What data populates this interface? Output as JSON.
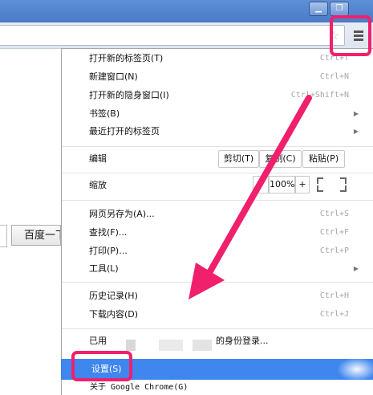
{
  "window": {
    "minimize_glyph": "▁",
    "maximize_glyph": "❐"
  },
  "page": {
    "baidu_button": "百度一下"
  },
  "menu": {
    "items": [
      {
        "label": "打开新的标签页(T)",
        "shortcut": "Ctrl+T"
      },
      {
        "label": "新建窗口(N)",
        "shortcut": "Ctrl+N"
      },
      {
        "label": "打开新的隐身窗口(I)",
        "shortcut": "Ctrl+Shift+N"
      },
      {
        "label": "书签(B)",
        "submenu": true
      },
      {
        "label": "最近打开的标签页",
        "submenu": true
      },
      {
        "label": "编辑"
      },
      {
        "label": "缩放"
      },
      {
        "label": "网页另存为(A)...",
        "shortcut": "Ctrl+S"
      },
      {
        "label": "查找(F)...",
        "shortcut": "Ctrl+F"
      },
      {
        "label": "打印(P)...",
        "shortcut": "Ctrl+P"
      },
      {
        "label": "工具(L)",
        "submenu": true
      },
      {
        "label": "历史记录(H)",
        "shortcut": "Ctrl+H"
      },
      {
        "label": "下载内容(D)",
        "shortcut": "Ctrl+J"
      }
    ],
    "edit": {
      "cut": "剪切(T)",
      "copy": "复制(C)",
      "paste": "粘贴(P)"
    },
    "zoom": {
      "minus": "-",
      "value": "100%",
      "plus": "+"
    },
    "signin": {
      "prefix": "已用",
      "suffix": "的身份登录..."
    },
    "settings": "设置(S)",
    "about": "关于 Google Chrome(G)"
  },
  "annotation": {
    "color": "#f0206c"
  },
  "colors": {
    "highlight": "#3f86ef",
    "titlebar": "#4a7cc7"
  }
}
